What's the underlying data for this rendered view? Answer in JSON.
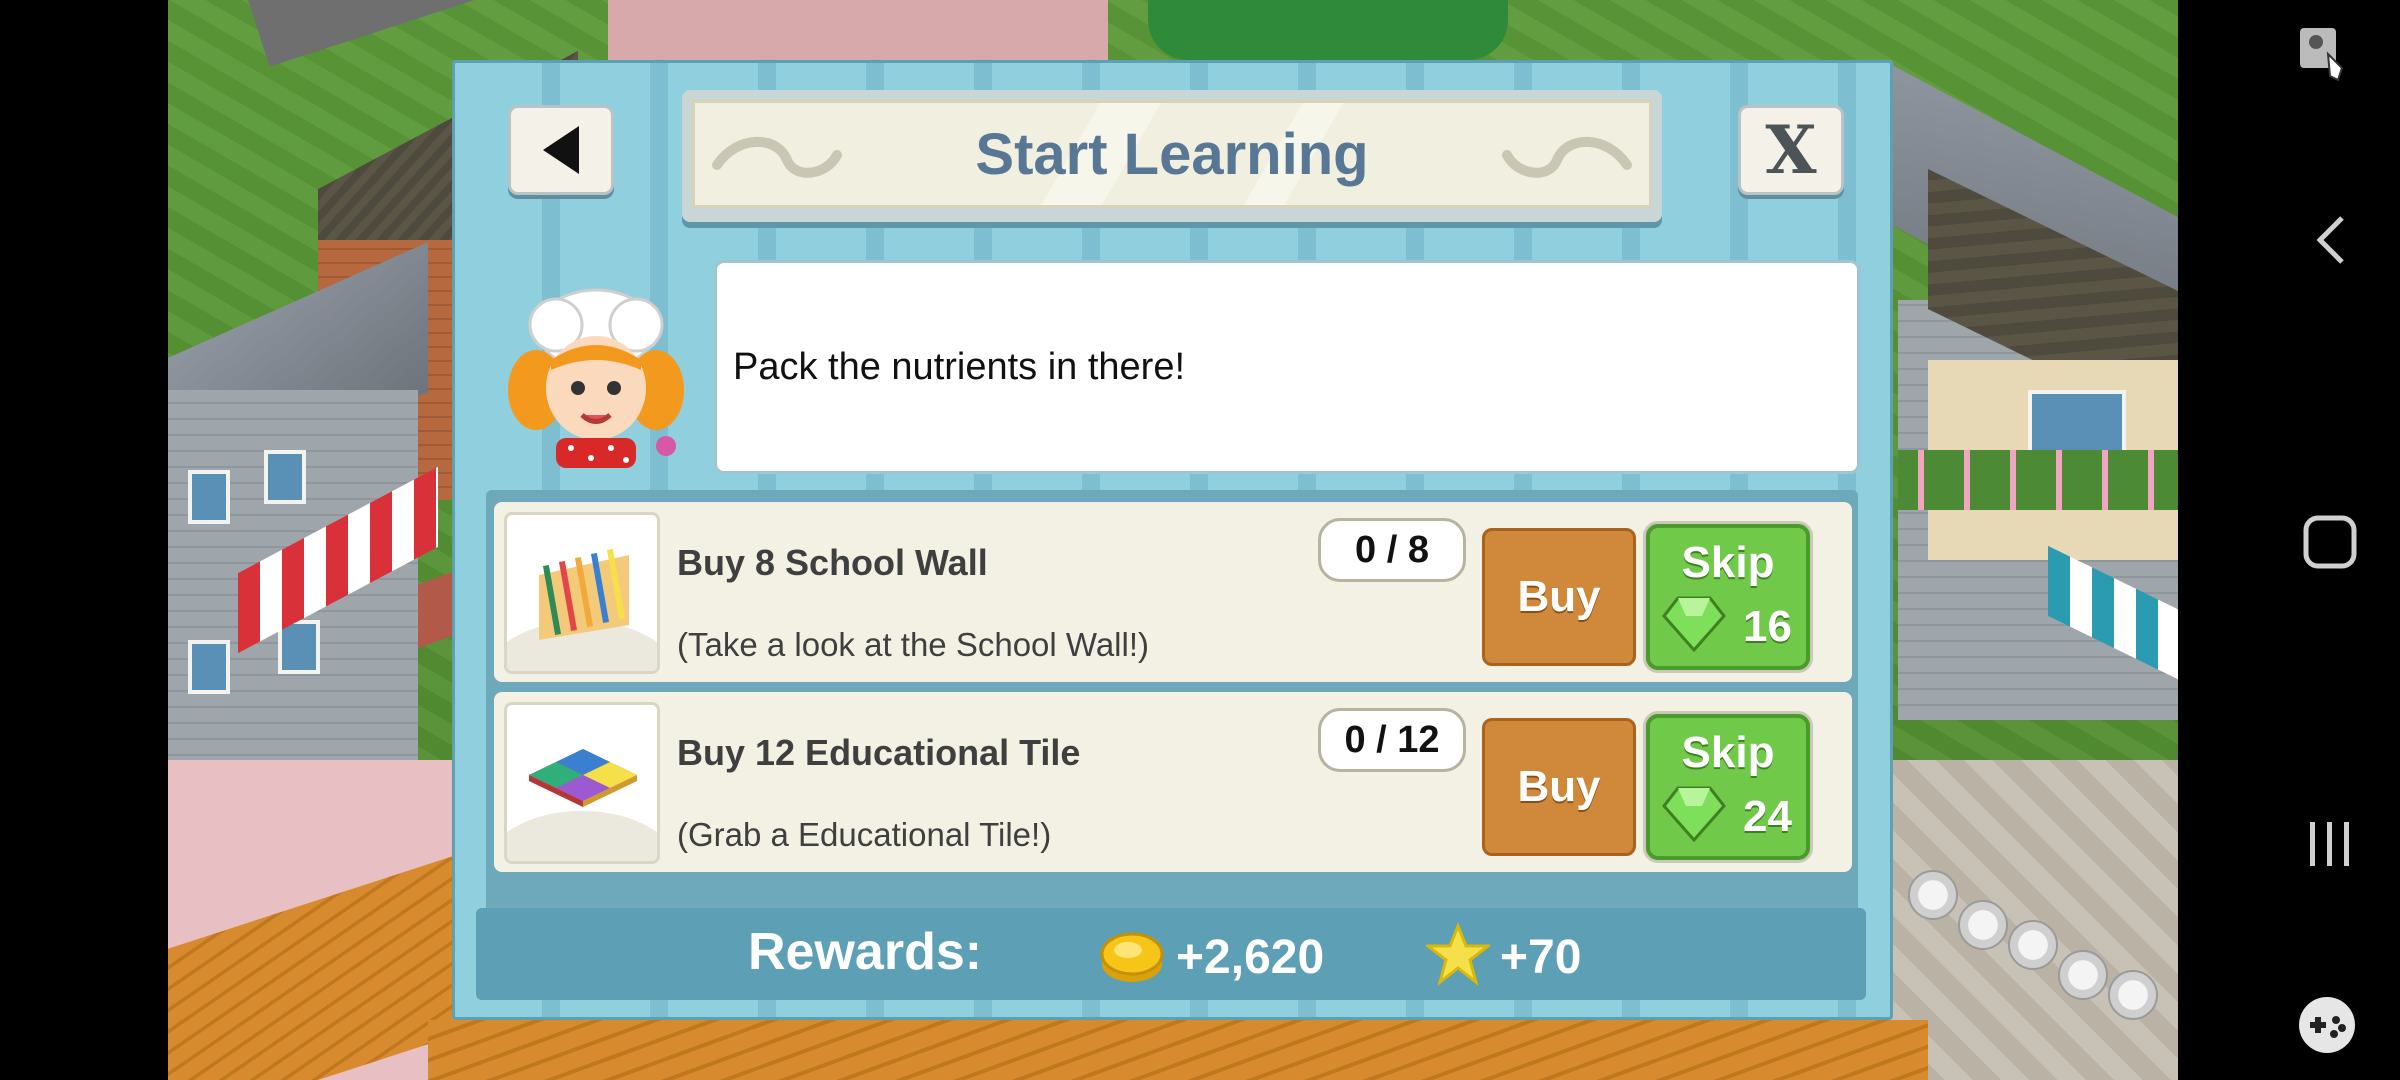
{
  "dialog": {
    "title": "Start Learning",
    "message": "Pack the nutrients in there!",
    "close_label": "X"
  },
  "tasks": [
    {
      "title": "Buy 8 School Wall",
      "description": "(Take a look at the School Wall!)",
      "progress": "0 / 8",
      "buy_label": "Buy",
      "skip_label": "Skip",
      "skip_cost": "16",
      "thumbnail_icon": "school-wall-icon"
    },
    {
      "title": "Buy 12 Educational Tile",
      "description": "(Grab a Educational Tile!)",
      "progress": "0 / 12",
      "buy_label": "Buy",
      "skip_label": "Skip",
      "skip_cost": "24",
      "thumbnail_icon": "educational-tile-icon"
    }
  ],
  "rewards": {
    "label": "Rewards:",
    "coins": "+2,620",
    "xp": "+70",
    "coin_icon": "gold-coins-icon",
    "xp_icon": "star-icon"
  },
  "colors": {
    "dialog_bg": "#8fcfde",
    "title_text": "#587795",
    "buy_button": "#d0883a",
    "skip_button": "#71c94a",
    "rewards_bar": "#5d9fb4"
  },
  "system_nav": {
    "icons": [
      "accessibility-icon",
      "back-icon",
      "home-icon",
      "recents-icon",
      "game-tools-icon"
    ]
  }
}
